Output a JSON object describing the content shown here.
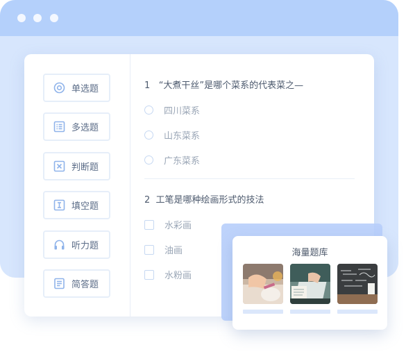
{
  "sidebar": {
    "items": [
      {
        "label": "单选题",
        "icon": "radio-icon"
      },
      {
        "label": "多选题",
        "icon": "list-icon"
      },
      {
        "label": "判断题",
        "icon": "cross-box-icon"
      },
      {
        "label": "填空题",
        "icon": "text-cursor-icon"
      },
      {
        "label": "听力题",
        "icon": "headphones-icon"
      },
      {
        "label": "简答题",
        "icon": "document-icon"
      }
    ]
  },
  "questions": [
    {
      "number": "1",
      "text": "“大煮干丝”是哪个菜系的代表菜之—",
      "type": "single",
      "options": [
        "四川菜系",
        "山东菜系",
        "广东菜系"
      ]
    },
    {
      "number": "2",
      "text": "工笔是哪种绘画形式的技法",
      "type": "multiple",
      "options": [
        "水彩画",
        "油画",
        "水粉画"
      ]
    }
  ],
  "question_bank": {
    "title": "海量题库",
    "images": [
      "study-desk-photo",
      "laptop-notes-photo",
      "chalkboard-photo"
    ]
  },
  "colors": {
    "accent": "#a9c7f4",
    "window_bg": "#d7e6fd",
    "titlebar": "#b4d0fb"
  }
}
